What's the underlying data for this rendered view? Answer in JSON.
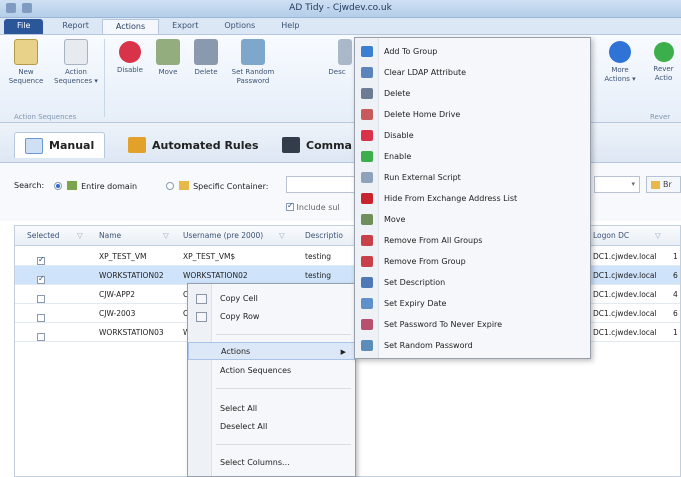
{
  "window": {
    "title": "AD Tidy - Cjwdev.co.uk"
  },
  "ribbon_tabs": [
    "File",
    "Report",
    "Actions",
    "Export",
    "Options",
    "Help"
  ],
  "ribbon": {
    "buttons": [
      {
        "label": "New Sequence",
        "icon": "new-sequence-icon",
        "color": "#d9b64a"
      },
      {
        "label": "Action Sequences ▾",
        "icon": "action-sequences-icon",
        "color": "#c9cfd8"
      },
      {
        "label": "Disable",
        "icon": "disable-icon",
        "color": "#d9334a"
      },
      {
        "label": "Move",
        "icon": "move-icon",
        "color": "#6f8f5a"
      },
      {
        "label": "Delete",
        "icon": "delete-icon",
        "color": "#6c7c93"
      },
      {
        "label": "Set Random Password",
        "icon": "set-random-password-icon",
        "color": "#5b8db8"
      },
      {
        "label": "Desc",
        "icon": "set-description-icon",
        "color": "#8e9fb6"
      }
    ],
    "right_buttons": [
      {
        "label": "More Actions ▾",
        "icon": "more-actions-icon",
        "color": "#2f73d6"
      },
      {
        "label": "Rever Actio",
        "icon": "revert-actions-icon",
        "color": "#3cae4b"
      }
    ],
    "group_label": "Action Sequences",
    "group_label_right": "Rever"
  },
  "view_tabs": [
    {
      "label": "Manual",
      "icon": "manual-icon",
      "color": "#6a98d3"
    },
    {
      "label": "Automated Rules",
      "icon": "automated-rules-icon",
      "color": "#e2a12a"
    },
    {
      "label": "Comma",
      "icon": "command-icon",
      "color": "#333c4a"
    }
  ],
  "search": {
    "label": "Search:",
    "option_entire": "Entire domain",
    "option_container": "Specific Container:",
    "include_sub": "Include sul",
    "dropdown_right": "Br"
  },
  "grid": {
    "columns": [
      "Selected",
      "Name",
      "Username (pre 2000)",
      "Descriptio",
      "Logon DC"
    ],
    "rows": [
      {
        "selected": true,
        "name": "XP_TEST_VM",
        "username": "XP_TEST_VM$",
        "description": "testing",
        "logon_dc": "DC1.cjwdev.local",
        "extra": "1",
        "highlight": false
      },
      {
        "selected": true,
        "name": "WORKSTATION02",
        "username": "WORKSTATION02",
        "description": "testing",
        "logon_dc": "DC1.cjwdev.local",
        "extra": "6",
        "highlight": true
      },
      {
        "selected": false,
        "name": "CJW-APP2",
        "username": "C",
        "description": "",
        "logon_dc": "DC1.cjwdev.local",
        "extra": "4",
        "highlight": false
      },
      {
        "selected": false,
        "name": "CJW-2003",
        "username": "C",
        "description": "",
        "logon_dc": "DC1.cjwdev.local",
        "extra": "6",
        "highlight": false
      },
      {
        "selected": false,
        "name": "WORKSTATION03",
        "username": "W",
        "description": "",
        "logon_dc": "DC1.cjwdev.local",
        "extra": "1",
        "highlight": false
      }
    ]
  },
  "context_menu": {
    "copy_cell": "Copy Cell",
    "copy_row": "Copy Row",
    "actions": "Actions",
    "action_sequences": "Action Sequences",
    "select_all": "Select All",
    "deselect_all": "Deselect All",
    "select_columns": "Select Columns..."
  },
  "actions_submenu": [
    {
      "label": "Add To Group",
      "icon": "add-to-group-icon",
      "color": "#3a7fd1"
    },
    {
      "label": "Clear LDAP Attribute",
      "icon": "clear-ldap-attribute-icon",
      "color": "#5b84bd"
    },
    {
      "label": "Delete",
      "icon": "delete-icon",
      "color": "#6c7c93"
    },
    {
      "label": "Delete Home Drive",
      "icon": "delete-home-drive-icon",
      "color": "#c75a5a"
    },
    {
      "label": "Disable",
      "icon": "disable-icon",
      "color": "#d9334a"
    },
    {
      "label": "Enable",
      "icon": "enable-icon",
      "color": "#3cae4b"
    },
    {
      "label": "Run External Script",
      "icon": "run-script-icon",
      "color": "#8fa2bb"
    },
    {
      "label": "Hide From Exchange Address List",
      "icon": "hide-exchange-icon",
      "color": "#c8242e"
    },
    {
      "label": "Move",
      "icon": "move-icon",
      "color": "#6f8f5a"
    },
    {
      "label": "Remove From All Groups",
      "icon": "remove-all-groups-icon",
      "color": "#c8414a"
    },
    {
      "label": "Remove From Group",
      "icon": "remove-group-icon",
      "color": "#c8414a"
    },
    {
      "label": "Set Description",
      "icon": "set-description-icon",
      "color": "#4f79b6"
    },
    {
      "label": "Set Expiry Date",
      "icon": "set-expiry-date-icon",
      "color": "#5e90c9"
    },
    {
      "label": "Set Password To Never Expire",
      "icon": "password-never-expire-icon",
      "color": "#b84f6e"
    },
    {
      "label": "Set Random Password",
      "icon": "set-random-password-icon",
      "color": "#5b8db8"
    }
  ]
}
